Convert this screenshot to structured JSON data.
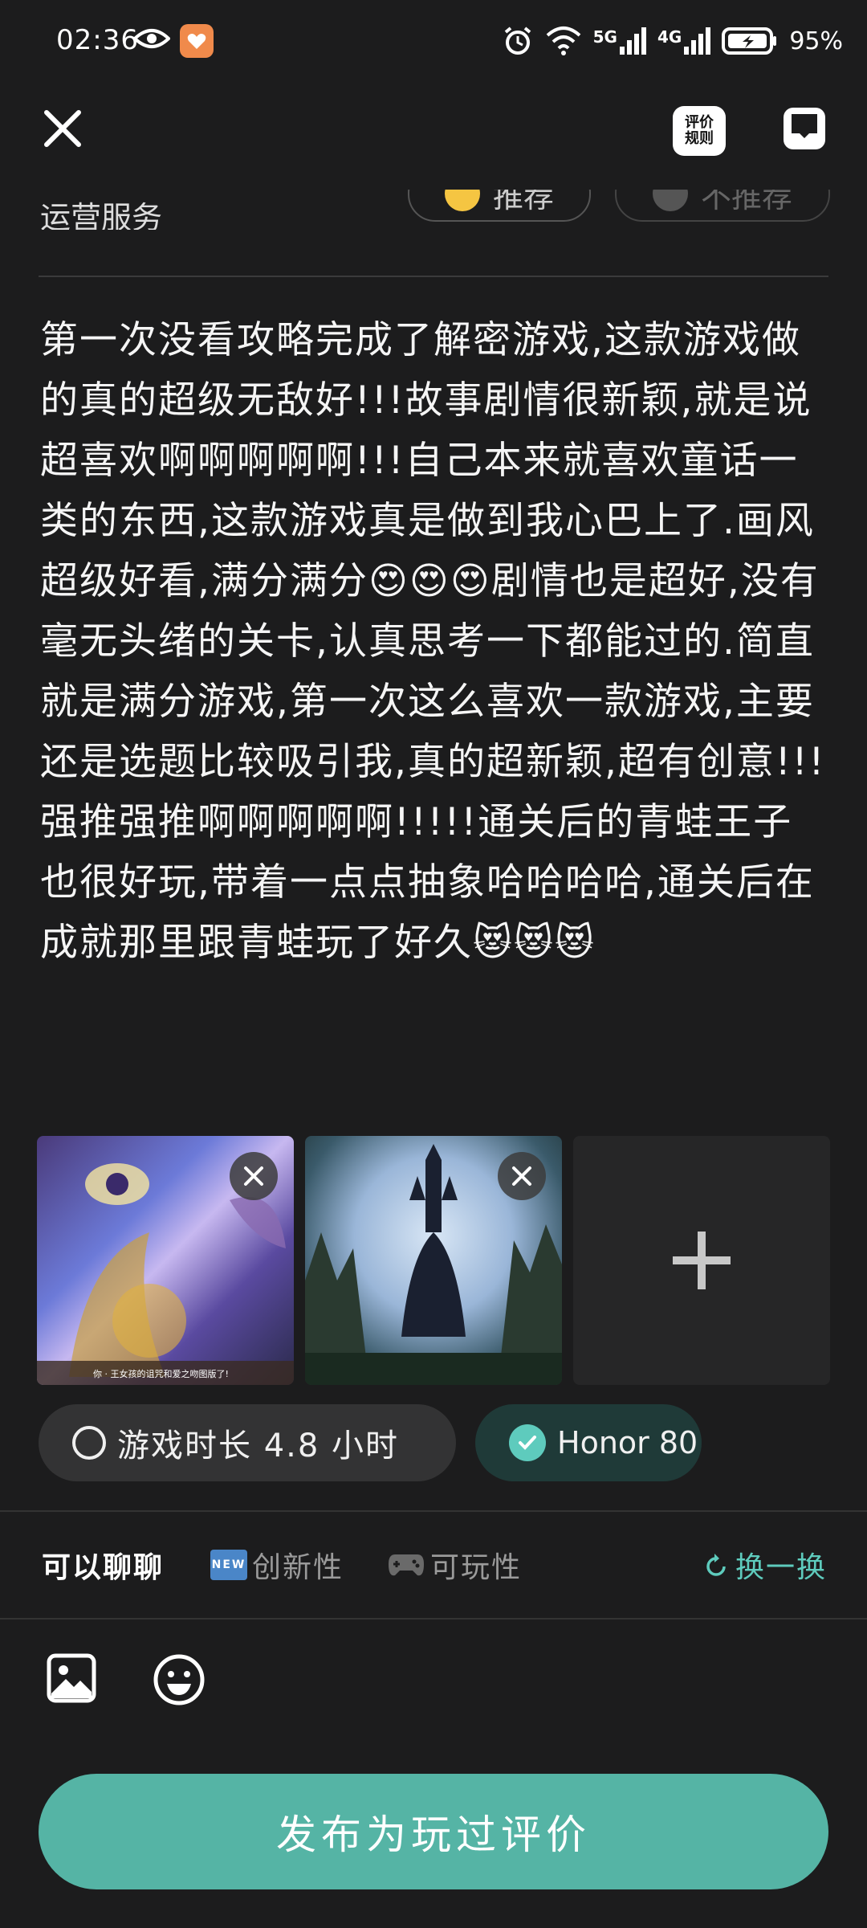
{
  "status_bar": {
    "time": "02:36",
    "network_5g": "5G",
    "network_4g": "4G",
    "battery": "95%"
  },
  "header": {
    "rules_label_line1": "评价",
    "rules_label_line2": "规则"
  },
  "clipped_row": {
    "label": "运营服务",
    "recommend": "推荐",
    "not_recommend": "不推荐"
  },
  "review": {
    "text": "第一次没看攻略完成了解密游戏,这款游戏做的真的超级无敌好!!!故事剧情很新颖,就是说超喜欢啊啊啊啊啊!!!自己本来就喜欢童话一类的东西,这款游戏真是做到我心巴上了.画风超级好看,满分满分😍😍😍剧情也是超好,没有毫无头绪的关卡,认真思考一下都能过的.简直就是满分游戏,第一次这么喜欢一款游戏,主要还是选题比较吸引我,真的超新颖,超有创意!!!强推强推啊啊啊啊啊!!!!!通关后的青蛙王子也很好玩,带着一点点抽象哈哈哈哈,通关后在成就那里跟青蛙玩了好久😻😻😻"
  },
  "photos": {
    "caption_1": "你 · 王女孩的诅咒和爱之吻图版了!"
  },
  "chips": {
    "play_time": "游戏时长 4.8 小时",
    "device": "Honor 80"
  },
  "topics": {
    "title": "可以聊聊",
    "new_badge": "NEW",
    "item_innovation": "创新性",
    "item_playability": "可玩性",
    "refresh": "换一换"
  },
  "publish": {
    "label": "发布为玩过评价"
  },
  "colors": {
    "accent": "#55b4a5",
    "accent_text": "#5ecbbd",
    "background": "#1c1c1d"
  }
}
